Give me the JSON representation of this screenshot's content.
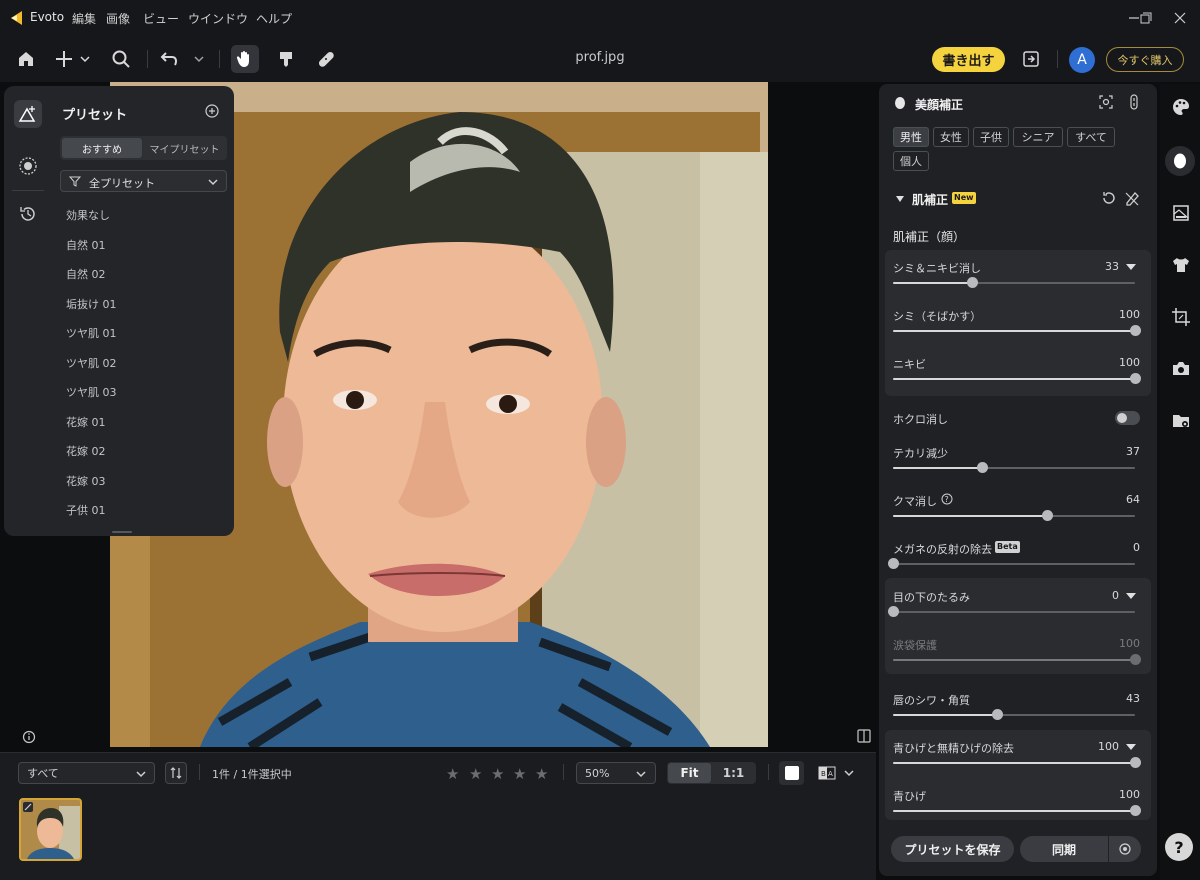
{
  "titlebar": {
    "app_name": "Evoto",
    "menus": [
      "編集",
      "画像",
      "ビュー",
      "ウインドウ",
      "ヘルプ"
    ]
  },
  "toolbar": {
    "filename": "prof.jpg",
    "export_label": "書き出す",
    "avatar_letter": "A",
    "buy_label": "今すぐ購入"
  },
  "presets": {
    "title": "プリセット",
    "tabs": [
      "おすすめ",
      "マイプリセット"
    ],
    "filter_label": "全プリセット",
    "items": [
      "効果なし",
      "自然 01",
      "自然 02",
      "垢抜け 01",
      "ツヤ肌 01",
      "ツヤ肌 02",
      "ツヤ肌 03",
      "花嫁 01",
      "花嫁 02",
      "花嫁 03",
      "子供 01"
    ]
  },
  "bottom": {
    "filter_select": "すべて",
    "count_text": "1件 / 1件選択中",
    "zoom_select": "50%",
    "fit_label": "Fit",
    "one_label": "1:1",
    "rating": 0,
    "rating_max": 5
  },
  "panel": {
    "title": "美顔補正",
    "chips": [
      "男性",
      "女性",
      "子供",
      "シニア",
      "すべて",
      "個人"
    ],
    "section_title": "肌補正",
    "new_badge": "New",
    "subsection": "肌補正（顔）",
    "sliders": [
      {
        "label": "シミ＆ニキビ消し",
        "value": 33,
        "max": 100,
        "dropdown": true
      },
      {
        "label": "シミ（そばかす）",
        "value": 100,
        "max": 100
      },
      {
        "label": "ニキビ",
        "value": 100,
        "max": 100
      },
      {
        "label": "テカリ減少",
        "value": 37,
        "max": 100
      },
      {
        "label": "クマ消し",
        "value": 64,
        "max": 100
      },
      {
        "label": "メガネの反射の除去",
        "value": 0,
        "max": 100,
        "badge": "Beta"
      },
      {
        "label": "目の下のたるみ",
        "value": 0,
        "max": 100,
        "dropdown": true
      },
      {
        "label": "涙袋保護",
        "value": 100,
        "max": 100,
        "disabled": true
      },
      {
        "label": "唇のシワ・角質",
        "value": 43,
        "max": 100
      },
      {
        "label": "青ひげと無精ひげの除去",
        "value": 100,
        "max": 100,
        "dropdown": true
      },
      {
        "label": "青ひげ",
        "value": 100,
        "max": 100
      }
    ],
    "toggle_label": "ホクロ消し",
    "toggle_on": false,
    "save_preset_label": "プリセットを保存",
    "sync_label": "同期"
  },
  "colors": {
    "accent_yellow": "#f5d33f",
    "avatar_blue": "#2f6fd3"
  }
}
